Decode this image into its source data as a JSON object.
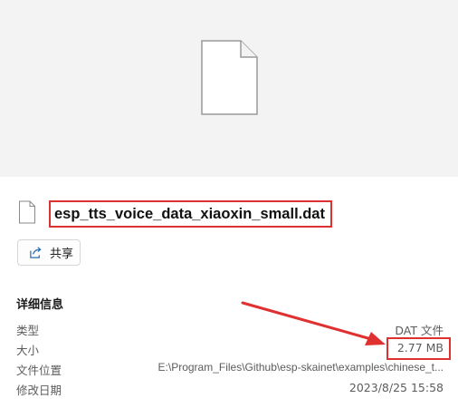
{
  "file": {
    "name": "esp_tts_voice_data_xiaoxin_small.dat"
  },
  "actions": {
    "share_label": "共享"
  },
  "details": {
    "title": "详细信息",
    "rows": [
      {
        "key": "类型",
        "value": "DAT 文件"
      },
      {
        "key": "大小",
        "value": "2.77 MB"
      },
      {
        "key": "文件位置",
        "value": "E:\\Program_Files\\Github\\esp-skainet\\examples\\chinese_t..."
      },
      {
        "key": "修改日期",
        "value": "2023/8/25 15:58"
      }
    ]
  },
  "annotations": {
    "highlight_color": "#e03131",
    "arrow_color": "#e03131"
  },
  "icons": {
    "preview": "document-icon",
    "file": "document-icon",
    "share": "share-icon"
  }
}
